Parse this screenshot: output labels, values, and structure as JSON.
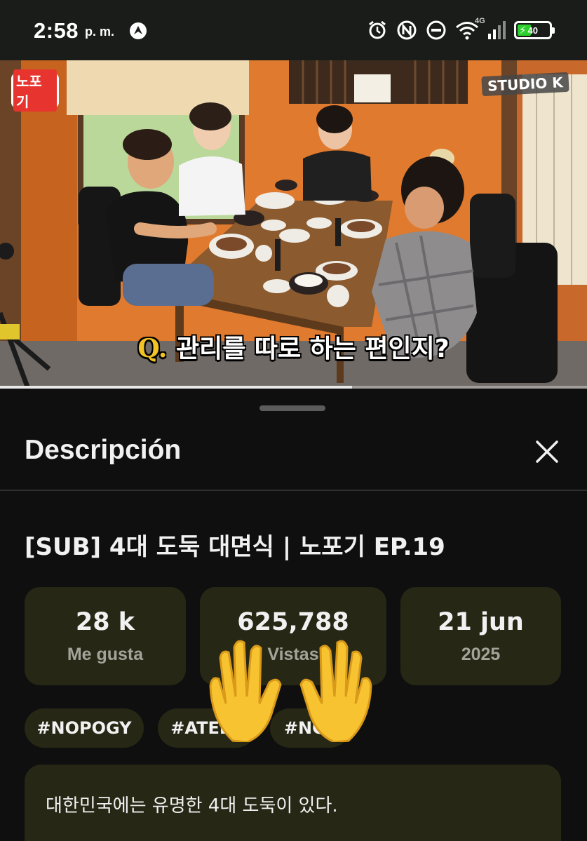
{
  "status_bar": {
    "time": "2:58",
    "ampm": "p. m.",
    "network": "4G",
    "battery": "40",
    "battery_level": 0.4
  },
  "video": {
    "show_logo": "노포기",
    "channel_logo": "STUDIO K",
    "subtitle_prefix": "Q.",
    "subtitle": "관리를 따로 하는 편인지?",
    "progress": 0.6
  },
  "sheet": {
    "header_title": "Descripción",
    "close_icon": "close-icon",
    "title": "[SUB] 4대 도둑 대면식 | 노포기 EP.19",
    "stats": [
      {
        "value": "28 k",
        "label": "Me gusta"
      },
      {
        "value": "625,788",
        "label": "Vistas"
      },
      {
        "value": "21 jun",
        "label": "2025"
      }
    ],
    "tags": [
      "#NOPOGY",
      "#ATEEZ",
      "#NCT"
    ],
    "description": "대한민국에는 유명한 4대 도둑이 있다."
  },
  "overlay": {
    "emoji": "waving-hands-emoji"
  },
  "colors": {
    "card_bg": "#272716",
    "sheet_bg": "#0f0f0f",
    "wall_orange": "#e8782b",
    "battery_green": "#2bd02b"
  }
}
